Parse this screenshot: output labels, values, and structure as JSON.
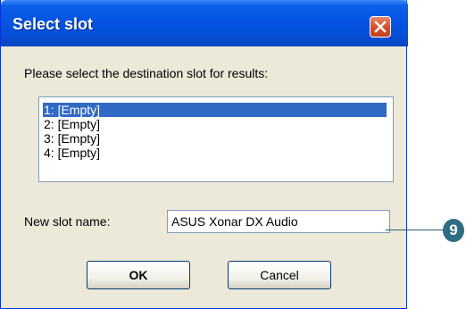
{
  "dialog": {
    "title": "Select slot",
    "close_icon": "close-icon",
    "prompt": "Please select the destination slot for results:",
    "slots": [
      {
        "label": "1: [Empty]",
        "selected": true
      },
      {
        "label": "2: [Empty]",
        "selected": false
      },
      {
        "label": "3: [Empty]",
        "selected": false
      },
      {
        "label": "4: [Empty]",
        "selected": false
      }
    ],
    "name_label": "New slot name:",
    "name_value": "ASUS Xonar DX Audio",
    "ok_label": "OK",
    "cancel_label": "Cancel"
  },
  "callout": {
    "number": "9"
  },
  "colors": {
    "titlebar": "#0554e3",
    "selection": "#316ac5",
    "callout": "#2e6e82",
    "close": "#d8502b"
  }
}
